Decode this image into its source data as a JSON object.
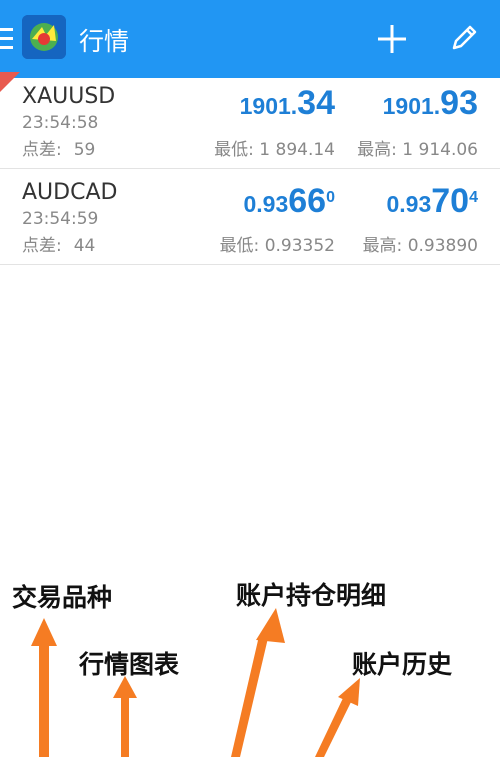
{
  "header": {
    "title": "行情",
    "brand_color": "#2196f3"
  },
  "quotes": [
    {
      "symbol": "XAUUSD",
      "time": "23:54:58",
      "spread_label": "点差:",
      "spread_value": "59",
      "bid": {
        "prefix": "1901.",
        "big": "34",
        "sup": ""
      },
      "ask": {
        "prefix": "1901.",
        "big": "93",
        "sup": ""
      },
      "low": "最低: 1 894.14",
      "high": "最高: 1 914.06"
    },
    {
      "symbol": "AUDCAD",
      "time": "23:54:59",
      "spread_label": "点差:",
      "spread_value": "44",
      "bid": {
        "prefix": "0.93",
        "big": "66",
        "sup": "0"
      },
      "ask": {
        "prefix": "0.93",
        "big": "70",
        "sup": "4"
      },
      "low": "最低: 0.93352",
      "high": "最高: 0.93890"
    }
  ],
  "price_color": "#1e7fd6",
  "annotations": {
    "symbols": "交易品种",
    "positions": "账户持仓明细",
    "chart": "行情图表",
    "history": "账户历史",
    "arrow_color": "#f57c23"
  },
  "icons": [
    "menu-icon",
    "app-logo-icon",
    "add-icon",
    "edit-icon"
  ]
}
